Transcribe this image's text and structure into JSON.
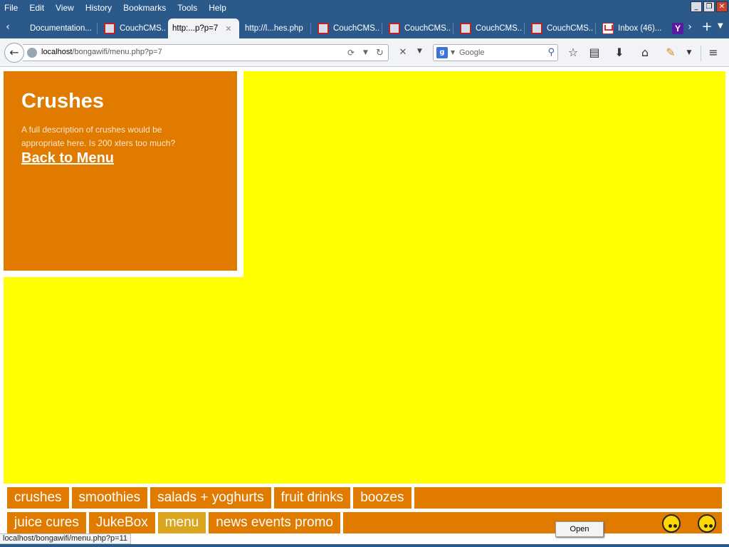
{
  "menubar": {
    "items": [
      "File",
      "Edit",
      "View",
      "History",
      "Bookmarks",
      "Tools",
      "Help"
    ]
  },
  "window_controls": {
    "minimize": "_",
    "restore": "❐",
    "close": "✕"
  },
  "tabs": [
    {
      "label": "Documentation...",
      "icon": "none"
    },
    {
      "label": "CouchCMS...",
      "icon": "couchcms-icon"
    },
    {
      "label": "http:...p?p=7",
      "icon": "none",
      "active": true
    },
    {
      "label": "http://l...hes.php",
      "icon": "none"
    },
    {
      "label": "CouchCMS...",
      "icon": "couchcms-icon"
    },
    {
      "label": "CouchCMS...",
      "icon": "couchcms-icon"
    },
    {
      "label": "CouchCMS...",
      "icon": "couchcms-icon"
    },
    {
      "label": "CouchCMS...",
      "icon": "couchcms-icon"
    },
    {
      "label": "Inbox (46)...",
      "icon": "gmail-icon"
    },
    {
      "label": "",
      "icon": "yahoo-icon"
    }
  ],
  "tab_close_glyph": "✕",
  "yahoo_glyph": "Y",
  "new_tab_glyph": "+",
  "url": {
    "host": "localhost",
    "path": "/bongawifi/menu.php?p=7"
  },
  "search": {
    "engine_glyph": "g",
    "placeholder": "Google"
  },
  "panel": {
    "title": "Crushes",
    "description": "A full description of crushes would be appropriate here. Is 200 xters too much?",
    "back_link": "Back to Menu"
  },
  "menu_row1": [
    "crushes",
    "smoothies",
    "salads + yoghurts",
    "fruit drinks",
    "boozes"
  ],
  "menu_row2": [
    "juice cures",
    "JukeBox",
    "menu",
    "news events promo"
  ],
  "active_menu_item": "menu",
  "open_button": "Open",
  "status_text": "localhost/bongawifi/menu.php?p=11",
  "colors": {
    "chrome": "#2b5a8a",
    "canvas": "#ffff00",
    "card": "#e07b00",
    "active_button": "#dba520"
  }
}
